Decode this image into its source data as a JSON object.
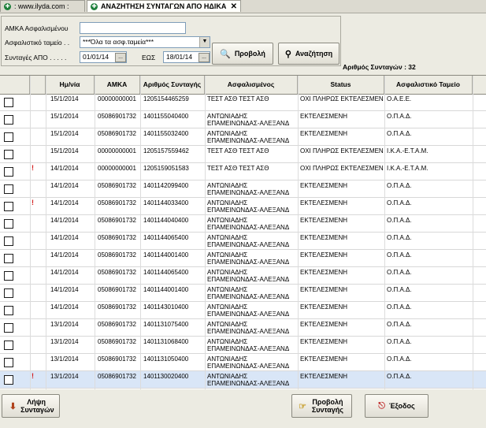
{
  "tabs": [
    {
      "label": ": www.ilyda.com :"
    },
    {
      "label": "ΑΝΑΖΗΤΗΣΗ ΣΥΝΤΑΓΩΝ ΑΠΟ ΗΔΙΚΑ",
      "close": "✕"
    }
  ],
  "filter": {
    "amka_label": "ΑΜΚΑ Ασφαλισμένου",
    "amka_value": "",
    "fund_label": "Ασφαλιστικό ταμείο . .",
    "fund_value": "***Όλα τα ασφ.ταμεία***",
    "from_label": "Συνταγές ΑΠΟ . . . . .",
    "from_value": "01/01/14",
    "to_label": "ΕΩΣ",
    "to_value": "18/01/14",
    "view_button": "Προβολή",
    "search_button": "Αναζήτηση",
    "picker_glyph": "...",
    "dropdown_glyph": "▼"
  },
  "count_label": "Αριθμός Συνταγών : 32",
  "columns": [
    "Ημ/νία",
    "ΑΜΚΑ",
    "Αριθμός Συνταγής",
    "Ασφαλισμένος",
    "Status",
    "Ασφαλιστικό Ταμείο"
  ],
  "rows": [
    {
      "warn": "",
      "date": "15/1/2014",
      "amka": "00000000001",
      "num": "1205154465259",
      "name1": "ΤΕΣΤ ΑΣΘ ΤΕΣΤ ΑΣΘ",
      "name2": "",
      "status": "ΟΧΙ ΠΛΗΡΩΣ ΕΚΤΕΛΕΣΜΕΝΗ",
      "fund": "Ο.Α.Ε.Ε."
    },
    {
      "warn": "",
      "date": "15/1/2014",
      "amka": "05086901732",
      "num": "1401155040400",
      "name1": "ΑΝΤΩΝΙΑΔΗΣ",
      "name2": "ΕΠΑΜΕΙΝΩΝΔΑΣ-ΑΛΕΞΑΝΔ",
      "status": "ΕΚΤΕΛΕΣΜΕΝΗ",
      "fund": "Ο.Π.Α.Δ."
    },
    {
      "warn": "",
      "date": "15/1/2014",
      "amka": "05086901732",
      "num": "1401155032400",
      "name1": "ΑΝΤΩΝΙΑΔΗΣ",
      "name2": "ΕΠΑΜΕΙΝΩΝΔΑΣ-ΑΛΕΞΑΝΔ",
      "status": "ΕΚΤΕΛΕΣΜΕΝΗ",
      "fund": "Ο.Π.Α.Δ."
    },
    {
      "warn": "",
      "date": "15/1/2014",
      "amka": "00000000001",
      "num": "1205157559462",
      "name1": "ΤΕΣΤ ΑΣΘ ΤΕΣΤ ΑΣΘ",
      "name2": "",
      "status": "ΟΧΙ ΠΛΗΡΩΣ ΕΚΤΕΛΕΣΜΕΝΗ",
      "fund": "Ι.Κ.Α.-Ε.Τ.Α.Μ."
    },
    {
      "warn": "!",
      "date": "14/1/2014",
      "amka": "00000000001",
      "num": "1205159051583",
      "name1": "ΤΕΣΤ ΑΣΘ ΤΕΣΤ ΑΣΘ",
      "name2": "",
      "status": "ΟΧΙ ΠΛΗΡΩΣ ΕΚΤΕΛΕΣΜΕΝΗ",
      "fund": "Ι.Κ.Α.-Ε.Τ.Α.Μ."
    },
    {
      "warn": "",
      "date": "14/1/2014",
      "amka": "05086901732",
      "num": "1401142099400",
      "name1": "ΑΝΤΩΝΙΑΔΗΣ",
      "name2": "ΕΠΑΜΕΙΝΩΝΔΑΣ-ΑΛΕΞΑΝΔ",
      "status": "ΕΚΤΕΛΕΣΜΕΝΗ",
      "fund": "Ο.Π.Α.Δ."
    },
    {
      "warn": "!",
      "date": "14/1/2014",
      "amka": "05086901732",
      "num": "1401144033400",
      "name1": "ΑΝΤΩΝΙΑΔΗΣ",
      "name2": "ΕΠΑΜΕΙΝΩΝΔΑΣ-ΑΛΕΞΑΝΔ",
      "status": "ΕΚΤΕΛΕΣΜΕΝΗ",
      "fund": "Ο.Π.Α.Δ."
    },
    {
      "warn": "",
      "date": "14/1/2014",
      "amka": "05086901732",
      "num": "1401144040400",
      "name1": "ΑΝΤΩΝΙΑΔΗΣ",
      "name2": "ΕΠΑΜΕΙΝΩΝΔΑΣ-ΑΛΕΞΑΝΔ",
      "status": "ΕΚΤΕΛΕΣΜΕΝΗ",
      "fund": "Ο.Π.Α.Δ."
    },
    {
      "warn": "",
      "date": "14/1/2014",
      "amka": "05086901732",
      "num": "1401144065400",
      "name1": "ΑΝΤΩΝΙΑΔΗΣ",
      "name2": "ΕΠΑΜΕΙΝΩΝΔΑΣ-ΑΛΕΞΑΝΔ",
      "status": "ΕΚΤΕΛΕΣΜΕΝΗ",
      "fund": "Ο.Π.Α.Δ."
    },
    {
      "warn": "",
      "date": "14/1/2014",
      "amka": "05086901732",
      "num": "1401144001400",
      "name1": "ΑΝΤΩΝΙΑΔΗΣ",
      "name2": "ΕΠΑΜΕΙΝΩΝΔΑΣ-ΑΛΕΞΑΝΔ",
      "status": "ΕΚΤΕΛΕΣΜΕΝΗ",
      "fund": "Ο.Π.Α.Δ."
    },
    {
      "warn": "",
      "date": "14/1/2014",
      "amka": "05086901732",
      "num": "1401144065400",
      "name1": "ΑΝΤΩΝΙΑΔΗΣ",
      "name2": "ΕΠΑΜΕΙΝΩΝΔΑΣ-ΑΛΕΞΑΝΔ",
      "status": "ΕΚΤΕΛΕΣΜΕΝΗ",
      "fund": "Ο.Π.Α.Δ."
    },
    {
      "warn": "",
      "date": "14/1/2014",
      "amka": "05086901732",
      "num": "1401144001400",
      "name1": "ΑΝΤΩΝΙΑΔΗΣ",
      "name2": "ΕΠΑΜΕΙΝΩΝΔΑΣ-ΑΛΕΞΑΝΔ",
      "status": "ΕΚΤΕΛΕΣΜΕΝΗ",
      "fund": "Ο.Π.Α.Δ."
    },
    {
      "warn": "",
      "date": "14/1/2014",
      "amka": "05086901732",
      "num": "1401143010400",
      "name1": "ΑΝΤΩΝΙΑΔΗΣ",
      "name2": "ΕΠΑΜΕΙΝΩΝΔΑΣ-ΑΛΕΞΑΝΔ",
      "status": "ΕΚΤΕΛΕΣΜΕΝΗ",
      "fund": "Ο.Π.Α.Δ."
    },
    {
      "warn": "",
      "date": "13/1/2014",
      "amka": "05086901732",
      "num": "1401131075400",
      "name1": "ΑΝΤΩΝΙΑΔΗΣ",
      "name2": "ΕΠΑΜΕΙΝΩΝΔΑΣ-ΑΛΕΞΑΝΔ",
      "status": "ΕΚΤΕΛΕΣΜΕΝΗ",
      "fund": "Ο.Π.Α.Δ."
    },
    {
      "warn": "",
      "date": "13/1/2014",
      "amka": "05086901732",
      "num": "1401131068400",
      "name1": "ΑΝΤΩΝΙΑΔΗΣ",
      "name2": "ΕΠΑΜΕΙΝΩΝΔΑΣ-ΑΛΕΞΑΝΔ",
      "status": "ΕΚΤΕΛΕΣΜΕΝΗ",
      "fund": "Ο.Π.Α.Δ."
    },
    {
      "warn": "",
      "date": "13/1/2014",
      "amka": "05086901732",
      "num": "1401131050400",
      "name1": "ΑΝΤΩΝΙΑΔΗΣ",
      "name2": "ΕΠΑΜΕΙΝΩΝΔΑΣ-ΑΛΕΞΑΝΔ",
      "status": "ΕΚΤΕΛΕΣΜΕΝΗ",
      "fund": "Ο.Π.Α.Δ."
    },
    {
      "warn": "!",
      "date": "13/1/2014",
      "amka": "05086901732",
      "num": "1401130020400",
      "name1": "ΑΝΤΩΝΙΑΔΗΣ",
      "name2": "ΕΠΑΜΕΙΝΩΝΔΑΣ-ΑΛΕΞΑΝΔ",
      "status": "ΕΚΤΕΛΕΣΜΕΝΗ",
      "fund": "Ο.Π.Α.Δ."
    }
  ],
  "bottom": {
    "fetch_button": "Λήψη Συνταγών",
    "view_rx_button": "Προβολή Συνταγής",
    "exit_button": "Έξοδος"
  }
}
